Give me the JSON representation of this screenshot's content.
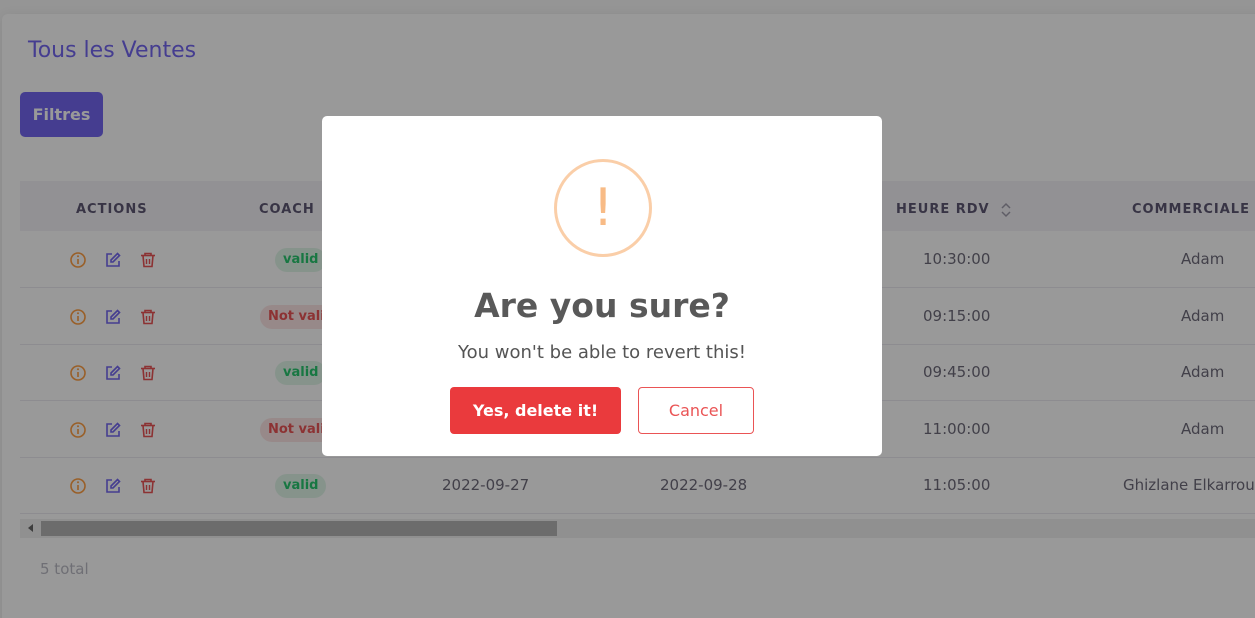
{
  "page": {
    "title": "Tous les Ventes",
    "filter_button": "Filtres",
    "total_text": "5 total"
  },
  "table": {
    "headers": {
      "actions": "ACTIONS",
      "coach": "COACH",
      "heure_rdv": "HEURE RDV",
      "commerciale": "COMMERCIALE"
    },
    "rows": [
      {
        "status": "valid",
        "date1": "",
        "date2": "",
        "heure": "10:30:00",
        "commerciale": "Adam"
      },
      {
        "status": "Not valid",
        "date1": "",
        "date2": "",
        "heure": "09:15:00",
        "commerciale": "Adam"
      },
      {
        "status": "valid",
        "date1": "",
        "date2": "",
        "heure": "09:45:00",
        "commerciale": "Adam"
      },
      {
        "status": "Not valid",
        "date1": "",
        "date2": "",
        "heure": "11:00:00",
        "commerciale": "Adam"
      },
      {
        "status": "valid",
        "date1": "2022-09-27",
        "date2": "2022-09-28",
        "heure": "11:05:00",
        "commerciale": "Ghizlane Elkarroumi"
      }
    ]
  },
  "modal": {
    "icon": "!",
    "title": "Are you sure?",
    "text": "You won't be able to revert this!",
    "confirm_label": "Yes, delete it!",
    "cancel_label": "Cancel"
  },
  "colors": {
    "primary": "#7367f0",
    "danger": "#ea5455",
    "warning_icon": "#f8bb86",
    "success": "#28c76f"
  },
  "icons": {
    "row_actions": [
      "info-icon",
      "edit-icon",
      "trash-icon"
    ],
    "sort": "sort-icon"
  }
}
